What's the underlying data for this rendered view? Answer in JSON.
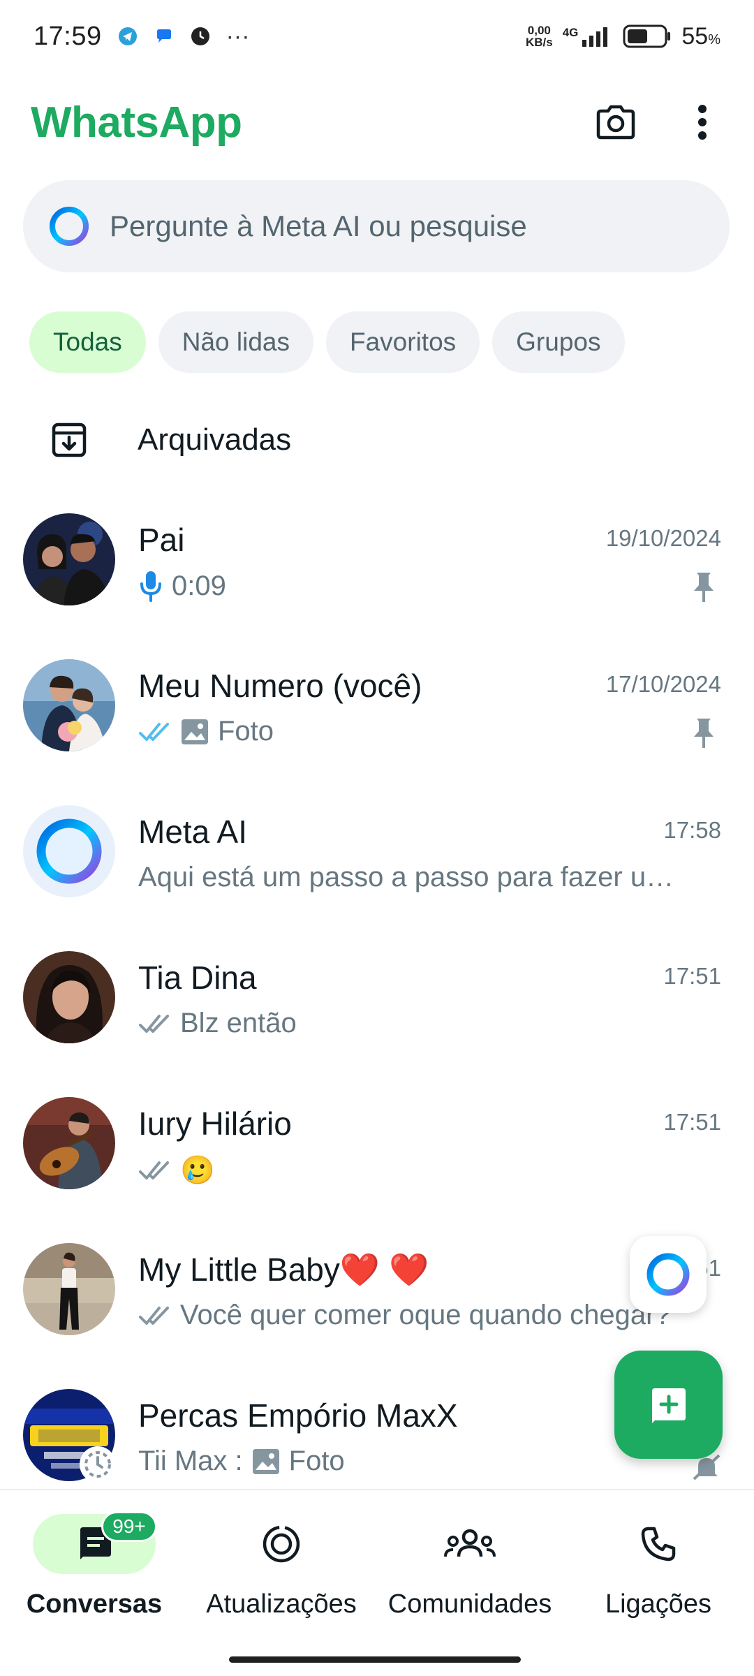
{
  "status_bar": {
    "time": "17:59",
    "dots": "···",
    "net_speed_value": "0,00",
    "net_speed_unit": "KB/s",
    "network": "4G",
    "battery_percent": "55",
    "battery_symbol": "%"
  },
  "header": {
    "title": "WhatsApp",
    "camera_icon": "camera-icon",
    "menu_icon": "more-vertical-icon"
  },
  "search": {
    "placeholder": "Pergunte à Meta AI ou pesquise"
  },
  "filters": [
    {
      "label": "Todas",
      "active": true
    },
    {
      "label": "Não lidas",
      "active": false
    },
    {
      "label": "Favoritos",
      "active": false
    },
    {
      "label": "Grupos",
      "active": false
    }
  ],
  "archived": {
    "label": "Arquivadas"
  },
  "chats": [
    {
      "name": "Pai",
      "time": "19/10/2024",
      "preview": "0:09",
      "pinned": true
    },
    {
      "name": "Meu Numero (você)",
      "time": "17/10/2024",
      "preview": "Foto",
      "pinned": true
    },
    {
      "name": "Meta AI",
      "time": "17:58",
      "preview": "Aqui está um passo a passo para fazer u…"
    },
    {
      "name": "Tia Dina",
      "time": "17:51",
      "preview": "Blz então"
    },
    {
      "name": "Iury Hilário",
      "time": "17:51",
      "preview": "🥲"
    },
    {
      "name": "My Little Baby❤️ ❤️",
      "time": "17:51",
      "preview": "Você quer comer oque quando chegar?"
    },
    {
      "name": "Percas Empório MaxX",
      "time": "",
      "sender": "Tii Max :",
      "preview": "Foto"
    }
  ],
  "bottom_nav": [
    {
      "label": "Conversas",
      "badge": "99+",
      "active": true
    },
    {
      "label": "Atualizações"
    },
    {
      "label": "Comunidades"
    },
    {
      "label": "Ligações"
    }
  ],
  "colors": {
    "brand_green": "#1daa61",
    "chip_active_bg": "#d8fdd2",
    "tick_blue": "#53bdeb",
    "mic_blue": "#1e88e5"
  }
}
